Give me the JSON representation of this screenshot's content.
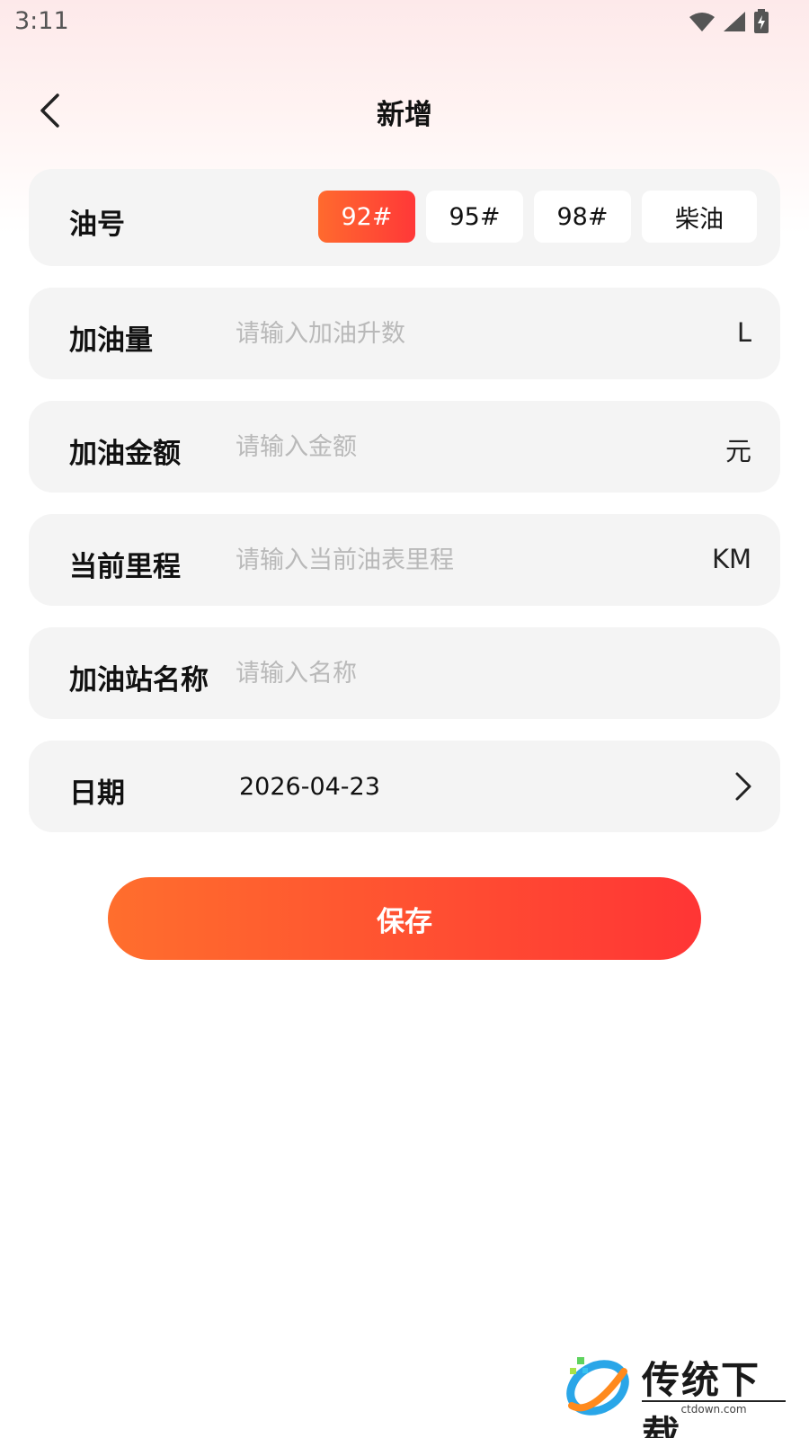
{
  "status_bar": {
    "time": "3:11"
  },
  "header": {
    "title": "新增"
  },
  "fuel": {
    "label": "油号",
    "options": [
      "92#",
      "95#",
      "98#",
      "柴油"
    ],
    "selected": "92#"
  },
  "volume": {
    "label": "加油量",
    "placeholder": "请输入加油升数",
    "unit": "L"
  },
  "amount": {
    "label": "加油金额",
    "placeholder": "请输入金额",
    "unit": "元"
  },
  "mileage": {
    "label": "当前里程",
    "placeholder": "请输入当前油表里程",
    "unit": "KM"
  },
  "station": {
    "label": "加油站名称",
    "placeholder": "请输入名称"
  },
  "date": {
    "label": "日期",
    "value": "2026-04-23"
  },
  "save_label": "保存",
  "watermark": {
    "title": "传统下载",
    "url": "ctdown.com"
  },
  "colors": {
    "accent_start": "#ff6e2d",
    "accent_end": "#ff3535",
    "card_bg": "#f4f4f4"
  },
  "icons": {
    "back": "chevron-left-icon",
    "date_chevron": "chevron-right-icon",
    "wifi": "wifi-icon",
    "signal": "signal-icon",
    "battery": "battery-charging-icon"
  }
}
